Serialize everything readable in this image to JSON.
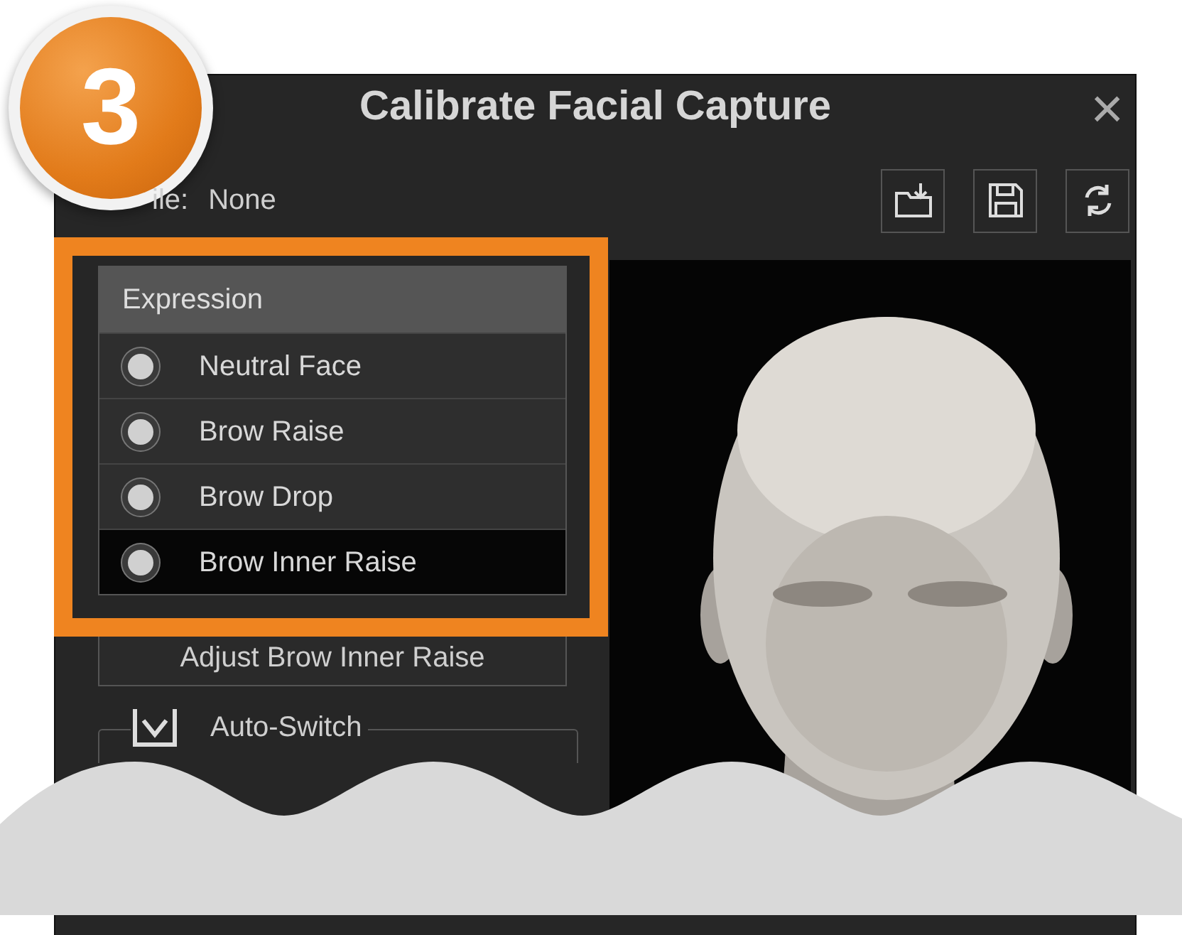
{
  "step_badge": {
    "label": "3"
  },
  "window": {
    "title": "Calibrate Facial Capture",
    "close": "×"
  },
  "profile": {
    "label": "ile:",
    "value": "None"
  },
  "expression_list": {
    "header": "Expression",
    "items": [
      {
        "label": "Neutral Face",
        "selected": false
      },
      {
        "label": "Brow Raise",
        "selected": false
      },
      {
        "label": "Brow Drop",
        "selected": false
      },
      {
        "label": "Brow Inner Raise",
        "selected": true
      }
    ]
  },
  "adjust_button": {
    "label": "Adjust Brow Inner Raise"
  },
  "auto_switch": {
    "label": "Auto-Switch",
    "checked": true
  }
}
